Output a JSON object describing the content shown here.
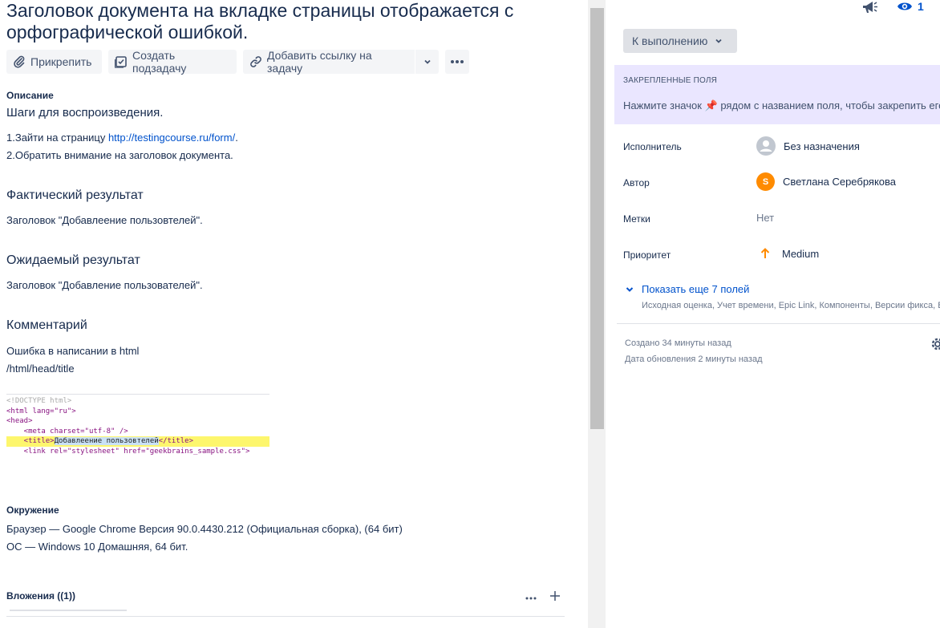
{
  "issue": {
    "title": "Заголовок документа на вкладке страницы отображается с орфографической ошибкой."
  },
  "toolbar": {
    "attach_label": "Прикрепить",
    "subtask_label": "Создать подзадачу",
    "link_label": "Добавить ссылку на задачу"
  },
  "description": {
    "label": "Описание",
    "steps_heading": "Шаги для воспроизведения.",
    "step1_prefix": "1.Зайти на страницу ",
    "step1_link": "http://testingcourse.ru/form/",
    "step1_suffix": ".",
    "step2": "2.Обратить внимание на заголовок документа.",
    "actual_heading": "Фактический результат",
    "actual_text": "Заголовок \"Добавлеение пользовтелей\".",
    "expected_heading": "Ожидаемый результат",
    "expected_text": "Заголовок \"Добавление пользователей\".",
    "comment_heading": "Комментарий",
    "comment_line1": "Ошибка в написании в html",
    "comment_line2": "/html/head/title"
  },
  "code_snippet": {
    "line1": "<!DOCTYPE html>",
    "line2": "<html lang=\"ru\">",
    "line3": "<head>",
    "line4": "    <meta charset=\"utf-8\" />",
    "line5_open": "    <title>",
    "line5_text": "Добавлеение пользовтелей",
    "line5_close": "</title>",
    "line6": "    <link rel=\"stylesheet\" href=\"geekbrains_sample.css\">"
  },
  "environment": {
    "label": "Окружение",
    "browser": "Браузер —  Google Chrome Версия 90.0.4430.212 (Официальная сборка), (64 бит)",
    "os": "ОС — Windows 10 Домашняя, 64 бит."
  },
  "attachments": {
    "label": "Вложения ((1))"
  },
  "header_right": {
    "watchers_count": "1"
  },
  "status": {
    "label": "К выполнению"
  },
  "pinned_fields": {
    "title": "ЗАКРЕПЛЕННЫЕ ПОЛЯ",
    "text": "Нажмите значок 📌 рядом с названием поля, чтобы закрепить его"
  },
  "fields": {
    "assignee_label": "Исполнитель",
    "assignee_value": "Без назначения",
    "reporter_label": "Автор",
    "reporter_initial": "S",
    "reporter_value": "Светлана Серебрякова",
    "labels_label": "Метки",
    "labels_value": "Нет",
    "priority_label": "Приоритет",
    "priority_value": "Medium"
  },
  "more_fields": {
    "label": "Показать еще 7 полей",
    "list": "Исходная оценка, Учет времени, Epic Link, Компоненты, Версии фикса, Bug"
  },
  "meta": {
    "created": "Создано 34 минуты назад",
    "updated": "Дата обновления 2 минуты назад"
  },
  "colors": {
    "link": "#0052cc",
    "pinned_bg": "#eae6ff",
    "priority_medium": "#ff8b00",
    "avatar": "#ff8b00"
  }
}
